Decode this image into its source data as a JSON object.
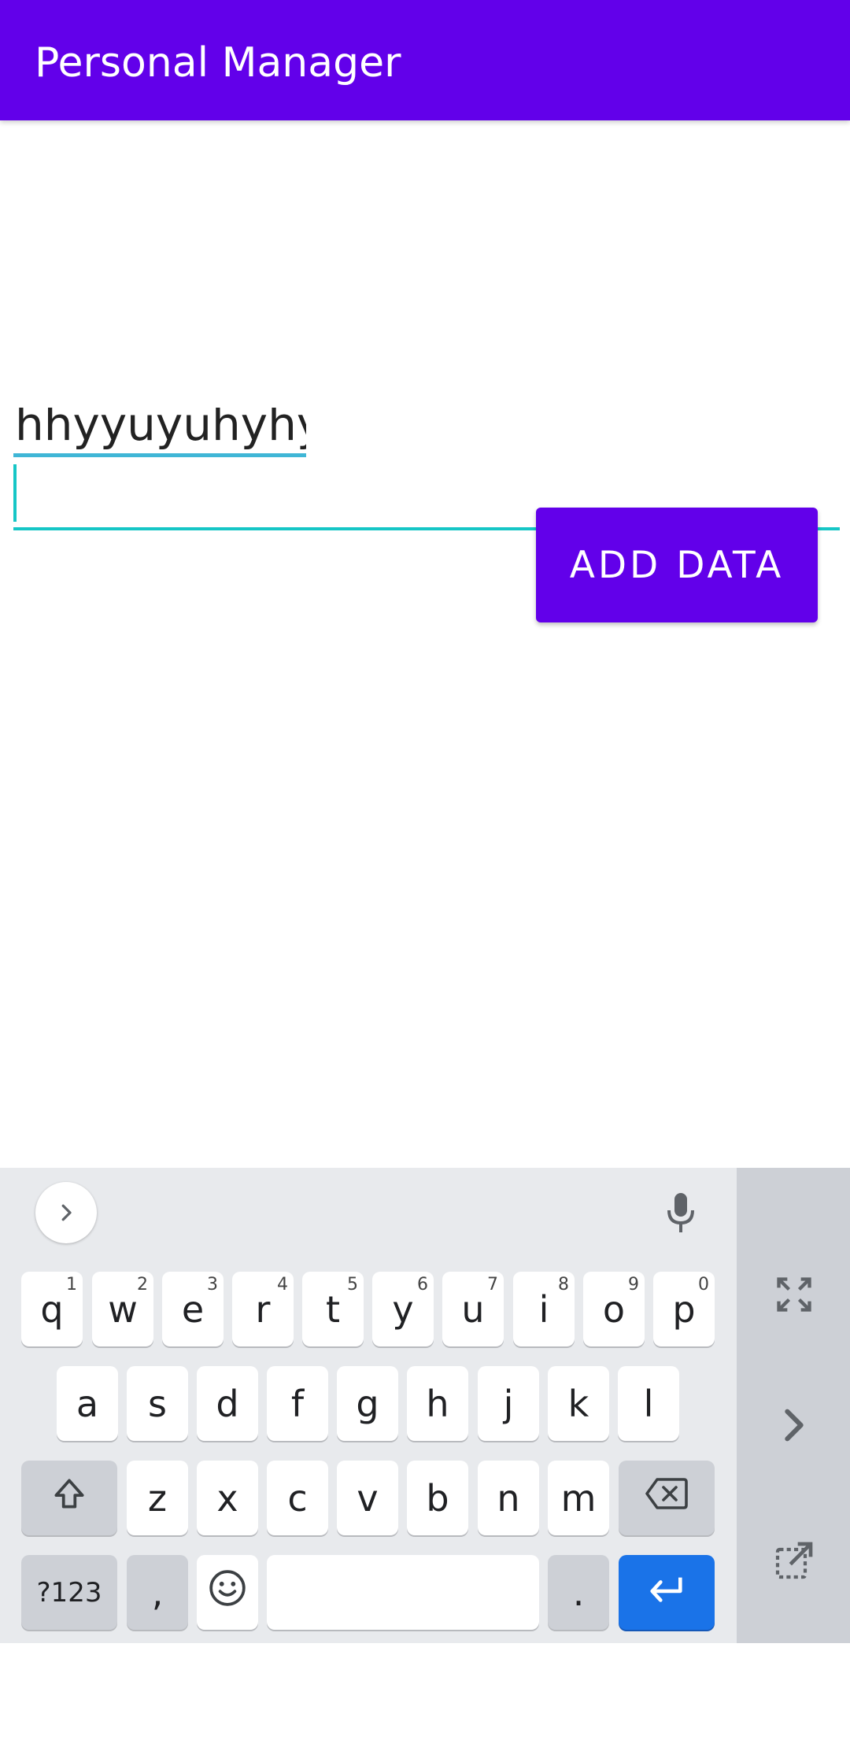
{
  "app_bar": {
    "title": "Personal Manager",
    "color": "#6200ea"
  },
  "form": {
    "field1_value": "hhyyuyuhyhy",
    "field2_value": "",
    "add_button_label": "ADD DATA"
  },
  "keyboard": {
    "row1": [
      {
        "label": "q",
        "hint": "1"
      },
      {
        "label": "w",
        "hint": "2"
      },
      {
        "label": "e",
        "hint": "3"
      },
      {
        "label": "r",
        "hint": "4"
      },
      {
        "label": "t",
        "hint": "5"
      },
      {
        "label": "y",
        "hint": "6"
      },
      {
        "label": "u",
        "hint": "7"
      },
      {
        "label": "i",
        "hint": "8"
      },
      {
        "label": "o",
        "hint": "9"
      },
      {
        "label": "p",
        "hint": "0"
      }
    ],
    "row2": [
      "a",
      "s",
      "d",
      "f",
      "g",
      "h",
      "j",
      "k",
      "l"
    ],
    "row3": [
      "z",
      "x",
      "c",
      "v",
      "b",
      "n",
      "m"
    ],
    "bottom": {
      "symbols": "?123",
      "comma": ",",
      "period": "."
    },
    "enter_color": "#1a73e8",
    "icons": [
      "chevron-right-icon",
      "mic-icon",
      "shift-icon",
      "backspace-icon",
      "emoji-icon",
      "enter-icon",
      "fullscreen-icon",
      "chevron-right-icon",
      "pop-out-icon"
    ]
  }
}
